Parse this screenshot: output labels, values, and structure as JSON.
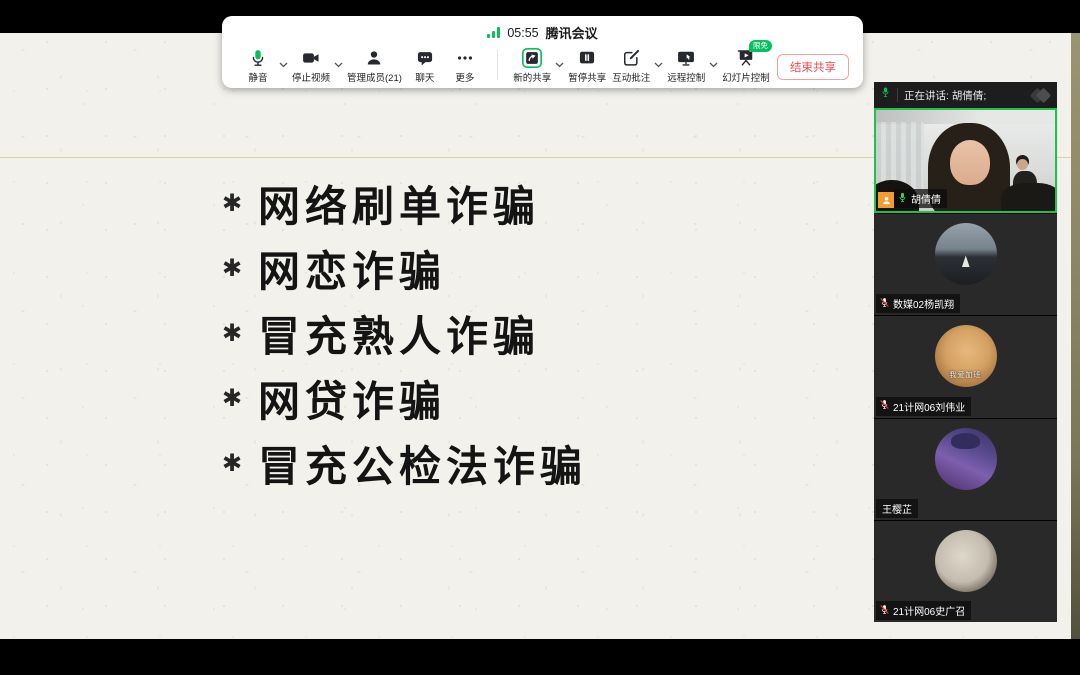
{
  "status": {
    "time": "05:55",
    "app": "腾讯会议"
  },
  "toolbar": {
    "mute": "静音",
    "stop_video": "停止视频",
    "members": "管理成员(21)",
    "chat": "聊天",
    "more": "更多",
    "new_share": "新的共享",
    "pause_share": "暂停共享",
    "annotate": "互动批注",
    "remote_control": "远程控制",
    "slide_control": "幻灯片控制",
    "slide_control_badge": "限免",
    "end_share": "结束共享"
  },
  "slide": {
    "bullet_glyph": "✱",
    "items": [
      "网络刷单诈骗",
      "网恋诈骗",
      "冒充熟人诈骗",
      "网贷诈骗",
      "冒充公检法诈骗"
    ]
  },
  "panel": {
    "speaking": "正在讲话: 胡倩倩;",
    "tiles": [
      {
        "name": "胡倩倩",
        "muted": false,
        "active": true,
        "host": true
      },
      {
        "name": "数媒02杨凯翔",
        "muted": true
      },
      {
        "name": "21计网06刘伟业",
        "muted": true,
        "caption": "我爱加班"
      },
      {
        "name": "王樱芷",
        "muted": false
      },
      {
        "name": "21计网06史广召",
        "muted": true
      }
    ]
  },
  "colors": {
    "accent_green": "#0abf5b",
    "danger_red": "#fa5151",
    "active_border": "#1fc04e",
    "panel_bg": "#1d1d1d",
    "tile_bg": "#292929",
    "slide_bg": "#f2f1ec",
    "slide_strip": "#8a8463"
  }
}
